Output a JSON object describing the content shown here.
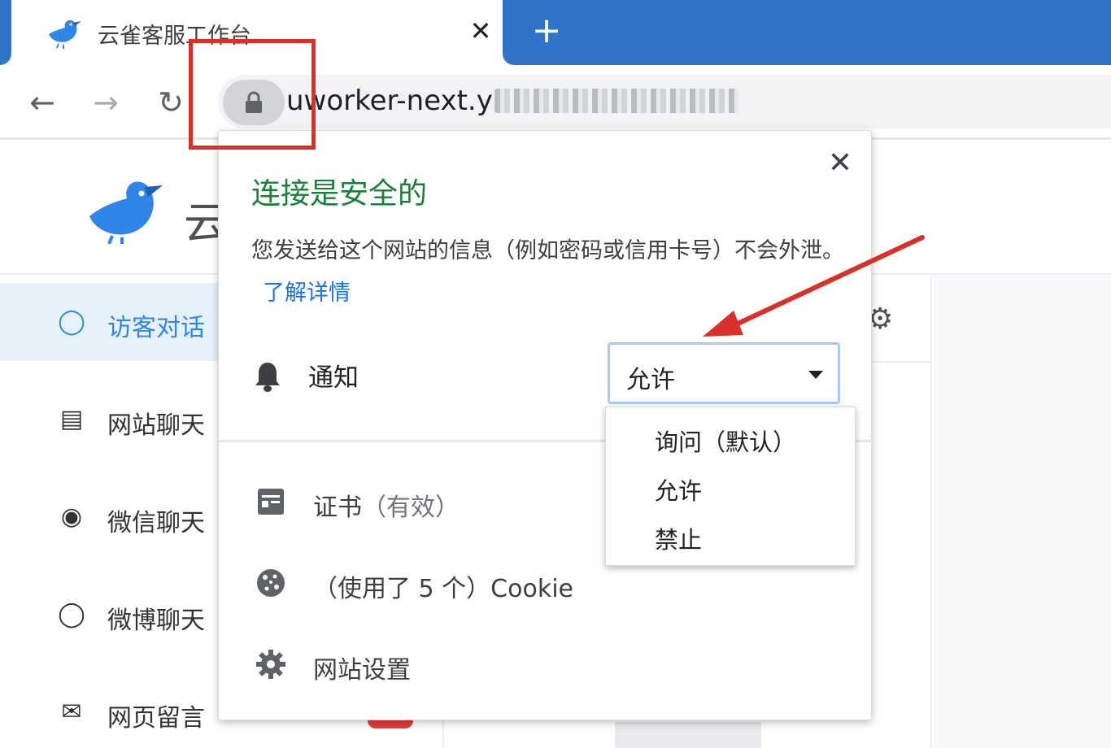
{
  "browser": {
    "tab": {
      "title": "云雀客服工作台",
      "close_glyph": "✕"
    },
    "new_tab_glyph": "+",
    "nav": {
      "back": "←",
      "forward": "→",
      "reload": "↻"
    },
    "address": {
      "url_visible": "uworker-next.y"
    }
  },
  "popup": {
    "title": "连接是安全的",
    "description": "您发送给这个网站的信息（例如密码或信用卡号）不会外泄。",
    "learn_more": "了解详情",
    "close_glyph": "✕",
    "permission": {
      "label": "通知",
      "selected": "允许"
    },
    "certificate": {
      "label": "证书",
      "status": "（有效）"
    },
    "cookie": {
      "label": "（使用了 5 个）Cookie"
    },
    "site_settings": {
      "label": "网站设置"
    }
  },
  "dropdown": {
    "options": [
      "询问（默认）",
      "允许",
      "禁止"
    ]
  },
  "page": {
    "brand_visible": "云",
    "sidebar": {
      "items": [
        {
          "label": "访客对话",
          "icon": "chat-bubble-icon",
          "active": true
        },
        {
          "label": "网站聊天",
          "icon": "document-icon"
        },
        {
          "label": "微信聊天",
          "icon": "wechat-icon"
        },
        {
          "label": "微博聊天",
          "icon": "weibo-icon"
        },
        {
          "label": "网页留言",
          "icon": "mail-icon"
        }
      ]
    }
  },
  "colors": {
    "tabstrip": "#2f74c8",
    "secure_green": "#188038",
    "link_blue": "#1a73e8",
    "highlight_red": "#d9312a",
    "sidebar_active_bg": "#e6f1fc",
    "sidebar_active_text": "#2f86e8"
  }
}
